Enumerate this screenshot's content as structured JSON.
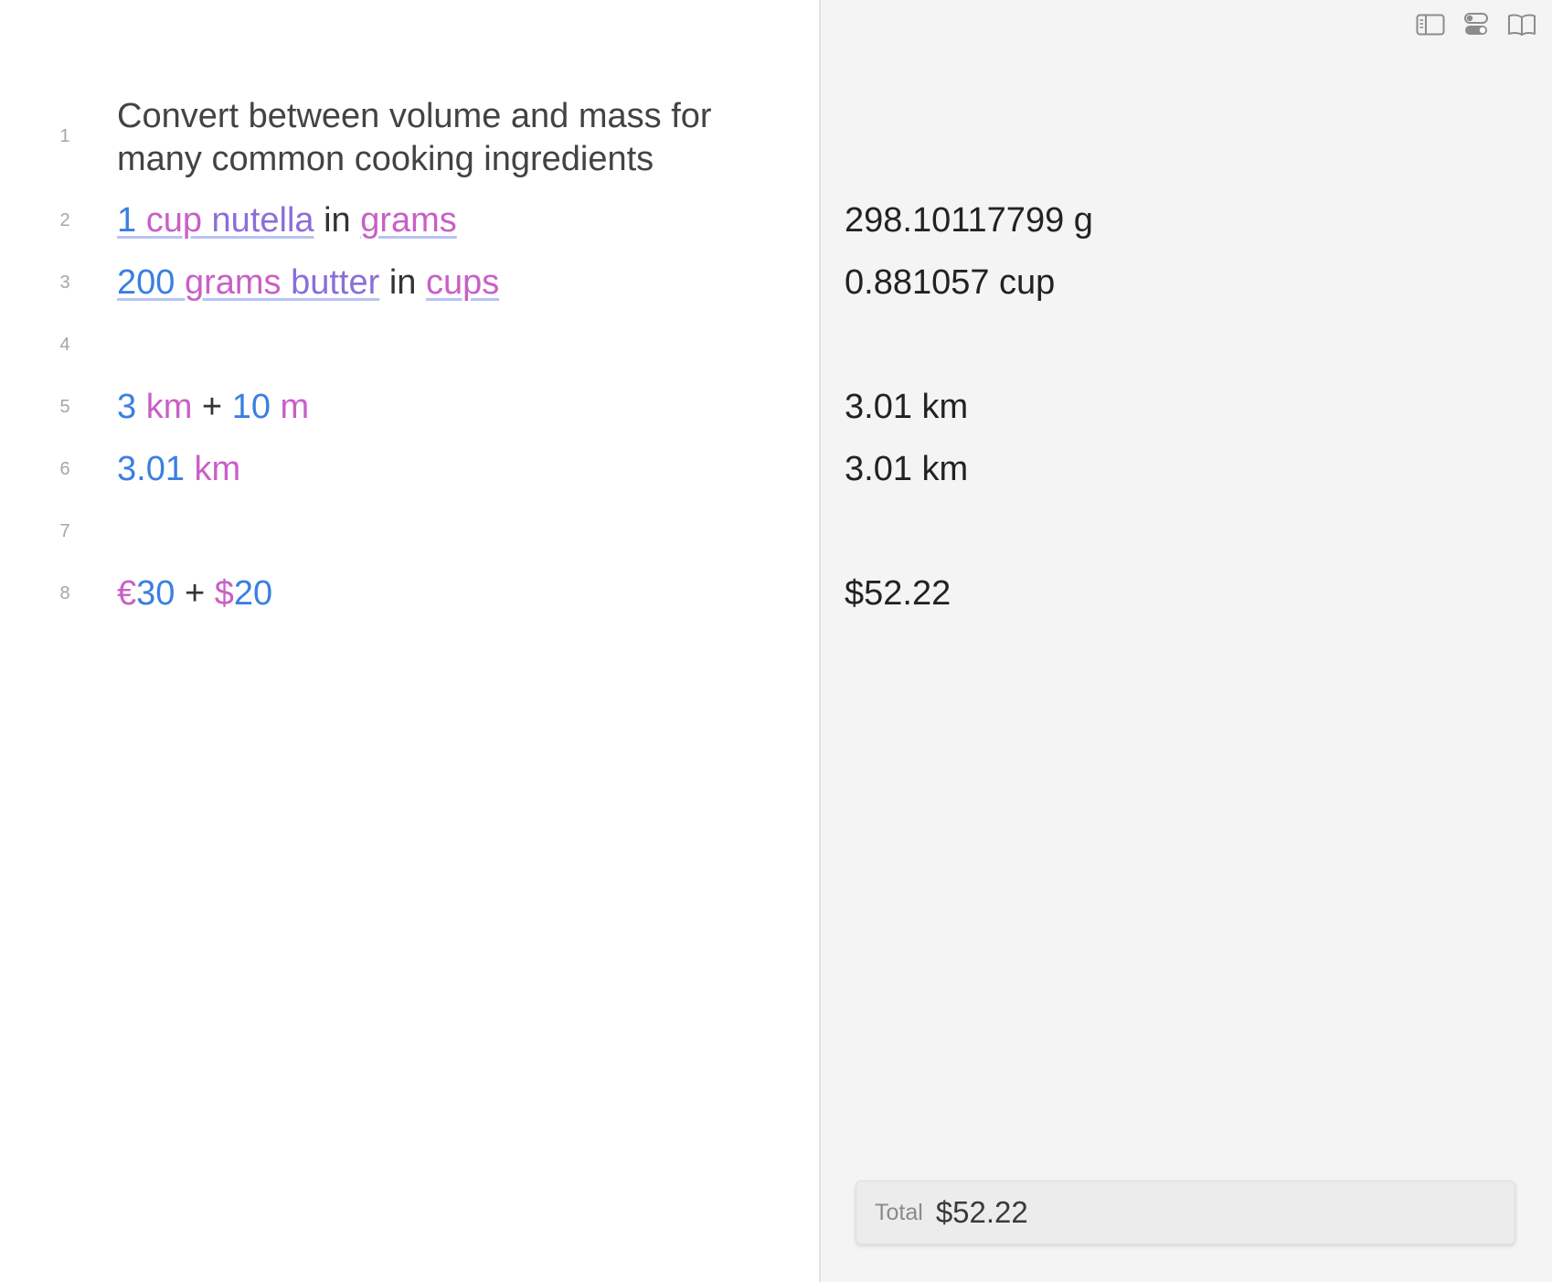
{
  "window": {
    "controls": [
      "close",
      "minimize",
      "zoom"
    ]
  },
  "toolbar": {
    "icons": [
      "sidebar-icon",
      "toggle-icon",
      "book-icon"
    ]
  },
  "editor": {
    "lines": [
      {
        "num": "1",
        "comment": "Convert between volume and mass for many common cooking ingredients"
      },
      {
        "num": "2",
        "tokens": [
          "1",
          "cup",
          "nutella",
          "in",
          "grams"
        ]
      },
      {
        "num": "3",
        "tokens": [
          "200",
          "grams",
          "butter",
          "in",
          "cups"
        ]
      },
      {
        "num": "4"
      },
      {
        "num": "5",
        "tokens": [
          "3",
          "km",
          "+",
          "10",
          "m"
        ]
      },
      {
        "num": "6",
        "tokens": [
          "3.01",
          "km"
        ]
      },
      {
        "num": "7"
      },
      {
        "num": "8",
        "tokens": [
          "€",
          "30",
          "+",
          "$",
          "20"
        ]
      }
    ]
  },
  "results": {
    "line2": "298.10117799 g",
    "line3": "0.881057 cup",
    "line5": "3.01 km",
    "line6": "3.01 km",
    "line8": "$52.22"
  },
  "total": {
    "label": "Total",
    "value": "$52.22"
  },
  "colors": {
    "number": "#3b7fe0",
    "unit": "#c95fc6",
    "ingredient": "#8a6fd8",
    "results_bg": "#f3f4f3"
  }
}
